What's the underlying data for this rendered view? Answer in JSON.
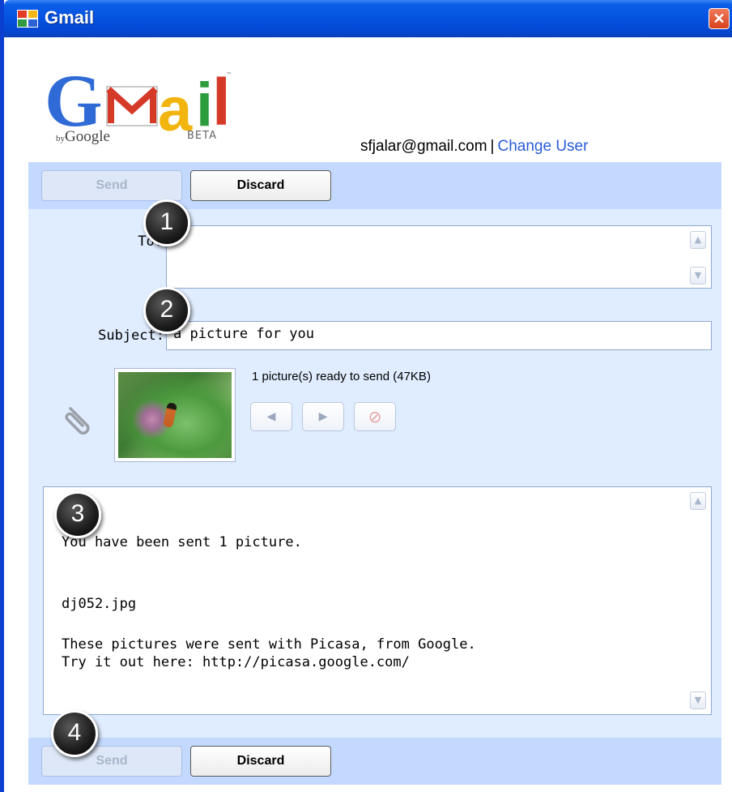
{
  "window": {
    "title": "Gmail",
    "close_label": "✕"
  },
  "logo": {
    "letters": [
      "G",
      "a",
      "i",
      "l"
    ],
    "by_prefix": "by",
    "by_brand": "Google",
    "beta": "BETA",
    "tm": "™"
  },
  "user": {
    "email": "sfjalar@gmail.com",
    "separator": "|",
    "change_user": "Change User"
  },
  "toolbar_top": {
    "send_label": "Send",
    "discard_label": "Discard"
  },
  "form": {
    "to_label": "To:",
    "to_value": "",
    "subject_label": "Subject:",
    "subject_value": "a picture for you"
  },
  "attachment": {
    "status": "1 picture(s) ready to send (47KB)",
    "prev_icon": "◀",
    "next_icon": "▶",
    "remove_icon": "⊘"
  },
  "message": {
    "line1": "You have been sent 1 picture.",
    "line2": "dj052.jpg",
    "line3": "These pictures were sent with Picasa, from Google.",
    "line4": "Try it out here: http://picasa.google.com/"
  },
  "toolbar_bottom": {
    "send_label": "Send",
    "discard_label": "Discard"
  },
  "callouts": [
    "1",
    "2",
    "3",
    "4"
  ],
  "scroll": {
    "up_icon": "▲",
    "down_icon": "▼"
  },
  "colors": {
    "titlebar": "#0552e0",
    "band": "#c3d9ff",
    "form_bg": "#e0ecff",
    "link": "#2a5bd7"
  }
}
